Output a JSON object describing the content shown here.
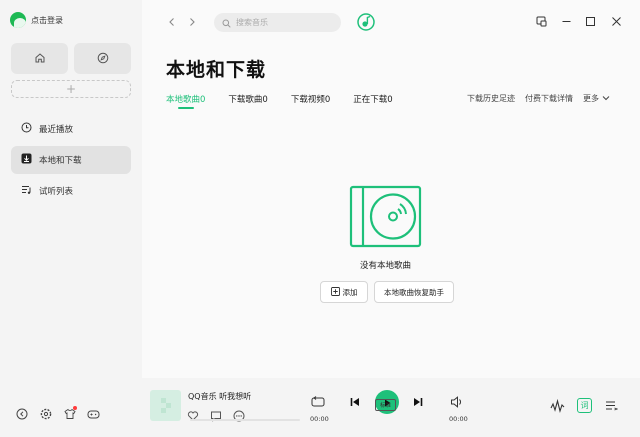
{
  "sidebar": {
    "user_label": "点击登录",
    "add_symbol": "+",
    "items": [
      {
        "label": "最近播放"
      },
      {
        "label": "本地和下载"
      },
      {
        "label": "试听列表"
      }
    ]
  },
  "topbar": {
    "search_placeholder": "搜索音乐"
  },
  "page": {
    "title": "本地和下载",
    "tabs": [
      {
        "label": "本地歌曲0"
      },
      {
        "label": "下载歌曲0"
      },
      {
        "label": "下载视频0"
      },
      {
        "label": "正在下载0"
      }
    ],
    "right_links": {
      "history": "下载历史足迹",
      "paid": "付费下载详情",
      "more": "更多"
    },
    "empty_text": "没有本地歌曲",
    "add_button": "添加",
    "recover_button": "本地歌曲恢复助手"
  },
  "player": {
    "song_title": "QQ音乐 听我想听",
    "current_time": "00:00",
    "total_time": "00:00",
    "quality_label": "标准",
    "lyrics_label": "词",
    "progress": 0
  },
  "colors": {
    "accent": "#1ec07a",
    "background": "#f4f4f4",
    "panel": "#fafafa"
  }
}
